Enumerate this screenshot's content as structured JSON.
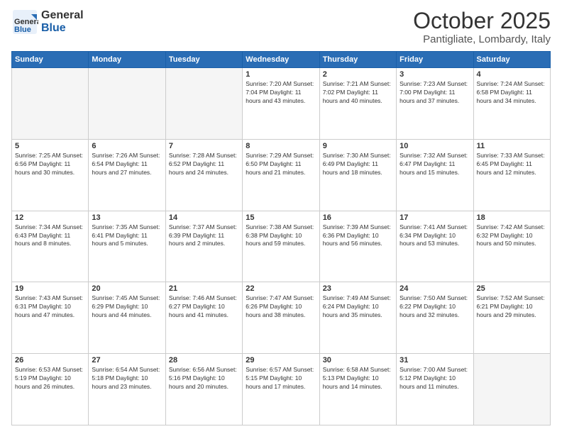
{
  "header": {
    "logo_general": "General",
    "logo_blue": "Blue",
    "month": "October 2025",
    "location": "Pantigliate, Lombardy, Italy"
  },
  "days_of_week": [
    "Sunday",
    "Monday",
    "Tuesday",
    "Wednesday",
    "Thursday",
    "Friday",
    "Saturday"
  ],
  "weeks": [
    [
      {
        "day": "",
        "info": ""
      },
      {
        "day": "",
        "info": ""
      },
      {
        "day": "",
        "info": ""
      },
      {
        "day": "1",
        "info": "Sunrise: 7:20 AM\nSunset: 7:04 PM\nDaylight: 11 hours\nand 43 minutes."
      },
      {
        "day": "2",
        "info": "Sunrise: 7:21 AM\nSunset: 7:02 PM\nDaylight: 11 hours\nand 40 minutes."
      },
      {
        "day": "3",
        "info": "Sunrise: 7:23 AM\nSunset: 7:00 PM\nDaylight: 11 hours\nand 37 minutes."
      },
      {
        "day": "4",
        "info": "Sunrise: 7:24 AM\nSunset: 6:58 PM\nDaylight: 11 hours\nand 34 minutes."
      }
    ],
    [
      {
        "day": "5",
        "info": "Sunrise: 7:25 AM\nSunset: 6:56 PM\nDaylight: 11 hours\nand 30 minutes."
      },
      {
        "day": "6",
        "info": "Sunrise: 7:26 AM\nSunset: 6:54 PM\nDaylight: 11 hours\nand 27 minutes."
      },
      {
        "day": "7",
        "info": "Sunrise: 7:28 AM\nSunset: 6:52 PM\nDaylight: 11 hours\nand 24 minutes."
      },
      {
        "day": "8",
        "info": "Sunrise: 7:29 AM\nSunset: 6:50 PM\nDaylight: 11 hours\nand 21 minutes."
      },
      {
        "day": "9",
        "info": "Sunrise: 7:30 AM\nSunset: 6:49 PM\nDaylight: 11 hours\nand 18 minutes."
      },
      {
        "day": "10",
        "info": "Sunrise: 7:32 AM\nSunset: 6:47 PM\nDaylight: 11 hours\nand 15 minutes."
      },
      {
        "day": "11",
        "info": "Sunrise: 7:33 AM\nSunset: 6:45 PM\nDaylight: 11 hours\nand 12 minutes."
      }
    ],
    [
      {
        "day": "12",
        "info": "Sunrise: 7:34 AM\nSunset: 6:43 PM\nDaylight: 11 hours\nand 8 minutes."
      },
      {
        "day": "13",
        "info": "Sunrise: 7:35 AM\nSunset: 6:41 PM\nDaylight: 11 hours\nand 5 minutes."
      },
      {
        "day": "14",
        "info": "Sunrise: 7:37 AM\nSunset: 6:39 PM\nDaylight: 11 hours\nand 2 minutes."
      },
      {
        "day": "15",
        "info": "Sunrise: 7:38 AM\nSunset: 6:38 PM\nDaylight: 10 hours\nand 59 minutes."
      },
      {
        "day": "16",
        "info": "Sunrise: 7:39 AM\nSunset: 6:36 PM\nDaylight: 10 hours\nand 56 minutes."
      },
      {
        "day": "17",
        "info": "Sunrise: 7:41 AM\nSunset: 6:34 PM\nDaylight: 10 hours\nand 53 minutes."
      },
      {
        "day": "18",
        "info": "Sunrise: 7:42 AM\nSunset: 6:32 PM\nDaylight: 10 hours\nand 50 minutes."
      }
    ],
    [
      {
        "day": "19",
        "info": "Sunrise: 7:43 AM\nSunset: 6:31 PM\nDaylight: 10 hours\nand 47 minutes."
      },
      {
        "day": "20",
        "info": "Sunrise: 7:45 AM\nSunset: 6:29 PM\nDaylight: 10 hours\nand 44 minutes."
      },
      {
        "day": "21",
        "info": "Sunrise: 7:46 AM\nSunset: 6:27 PM\nDaylight: 10 hours\nand 41 minutes."
      },
      {
        "day": "22",
        "info": "Sunrise: 7:47 AM\nSunset: 6:26 PM\nDaylight: 10 hours\nand 38 minutes."
      },
      {
        "day": "23",
        "info": "Sunrise: 7:49 AM\nSunset: 6:24 PM\nDaylight: 10 hours\nand 35 minutes."
      },
      {
        "day": "24",
        "info": "Sunrise: 7:50 AM\nSunset: 6:22 PM\nDaylight: 10 hours\nand 32 minutes."
      },
      {
        "day": "25",
        "info": "Sunrise: 7:52 AM\nSunset: 6:21 PM\nDaylight: 10 hours\nand 29 minutes."
      }
    ],
    [
      {
        "day": "26",
        "info": "Sunrise: 6:53 AM\nSunset: 5:19 PM\nDaylight: 10 hours\nand 26 minutes."
      },
      {
        "day": "27",
        "info": "Sunrise: 6:54 AM\nSunset: 5:18 PM\nDaylight: 10 hours\nand 23 minutes."
      },
      {
        "day": "28",
        "info": "Sunrise: 6:56 AM\nSunset: 5:16 PM\nDaylight: 10 hours\nand 20 minutes."
      },
      {
        "day": "29",
        "info": "Sunrise: 6:57 AM\nSunset: 5:15 PM\nDaylight: 10 hours\nand 17 minutes."
      },
      {
        "day": "30",
        "info": "Sunrise: 6:58 AM\nSunset: 5:13 PM\nDaylight: 10 hours\nand 14 minutes."
      },
      {
        "day": "31",
        "info": "Sunrise: 7:00 AM\nSunset: 5:12 PM\nDaylight: 10 hours\nand 11 minutes."
      },
      {
        "day": "",
        "info": ""
      }
    ]
  ]
}
